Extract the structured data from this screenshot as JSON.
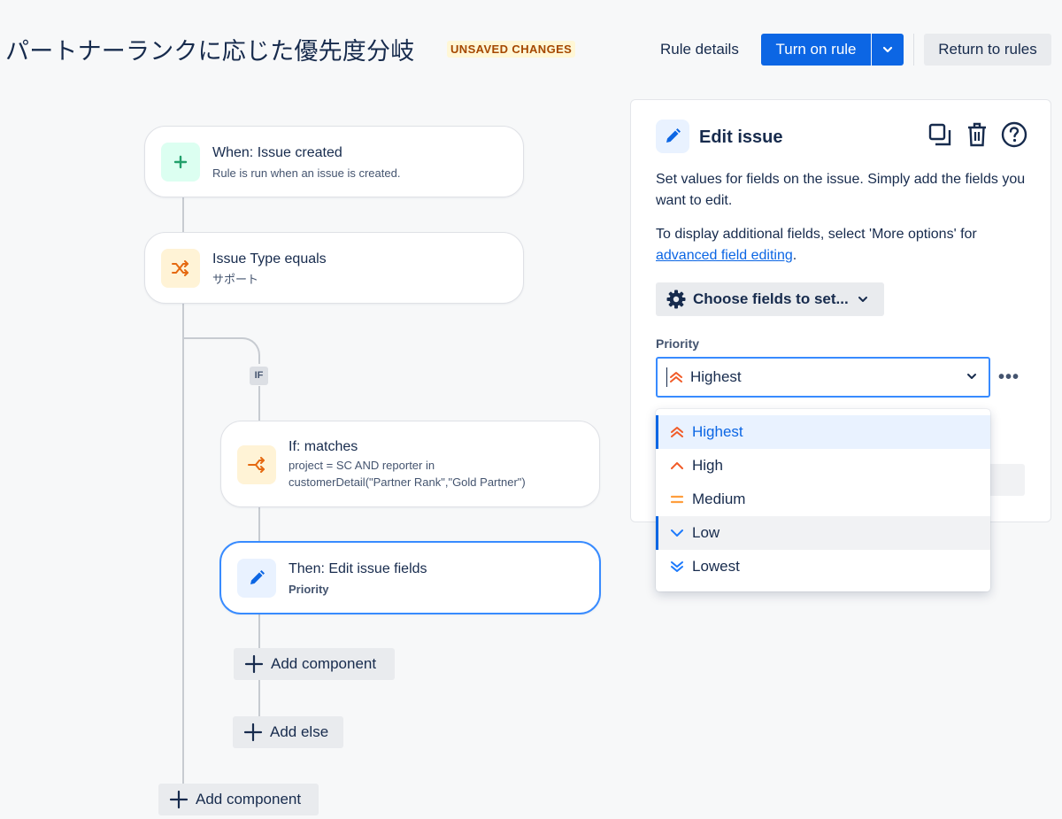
{
  "header": {
    "title": "パートナーランクに応じた優先度分岐",
    "badge": "UNSAVED CHANGES",
    "rule_details": "Rule details",
    "turn_on": "Turn on rule",
    "return": "Return to rules"
  },
  "flow": {
    "trigger": {
      "title": "When: Issue created",
      "subtitle": "Rule is run when an issue is created.",
      "icon": "plus-icon"
    },
    "condition": {
      "title": "Issue Type equals",
      "subtitle": "サポート",
      "icon": "shuffle-icon"
    },
    "if_badge": "IF",
    "if_block": {
      "title": "If: matches",
      "line1": "project = SC AND reporter in",
      "line2": "customerDetail(\"Partner Rank\",\"Gold Partner\")",
      "icon": "branch-icon"
    },
    "then_block": {
      "title": "Then: Edit issue fields",
      "subtitle": "Priority",
      "icon": "pencil-icon"
    },
    "add_component_inner": "Add component",
    "add_else": "Add else",
    "add_component_outer": "Add component"
  },
  "panel": {
    "title": "Edit issue",
    "desc_1": "Set values for fields on the issue. Simply add the fields you want to edit.",
    "desc_2_prefix": "To display additional fields, select 'More options' for",
    "desc_2_link": "advanced field editing",
    "desc_2_suffix": ".",
    "choose_fields": "Choose fields to set...",
    "priority_label": "Priority",
    "priority_value": "Highest",
    "more_label": "•••",
    "tools": [
      "copy-icon",
      "trash-icon",
      "help-icon"
    ]
  },
  "dropdown": {
    "options": [
      {
        "label": "Highest",
        "icon": "priority-highest-icon",
        "state": "selected"
      },
      {
        "label": "High",
        "icon": "priority-high-icon",
        "state": ""
      },
      {
        "label": "Medium",
        "icon": "priority-medium-icon",
        "state": ""
      },
      {
        "label": "Low",
        "icon": "priority-low-icon",
        "state": "hovered"
      },
      {
        "label": "Lowest",
        "icon": "priority-lowest-icon",
        "state": ""
      }
    ]
  },
  "colors": {
    "primary": "#0c66e4",
    "priority_high": "#f15b28",
    "priority_medium": "#ff9e3d",
    "priority_low": "#1d7afc",
    "green": "#22a06b",
    "orange": "#e56910"
  }
}
